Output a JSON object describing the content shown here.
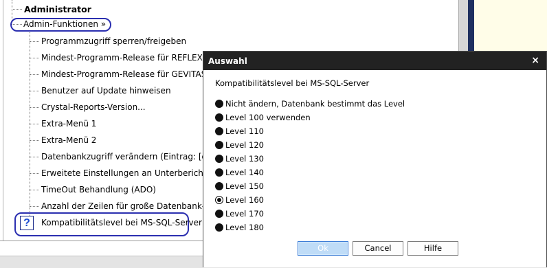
{
  "tree": {
    "root_label": "Administrator",
    "group_label": "Admin-Funktionen »",
    "items": [
      "Programmzugriff sperren/freigeben",
      "Mindest-Programm-Release für REFLEX festl",
      "Mindest-Programm-Release für GEVITAS-For",
      "Benutzer auf Update hinweisen",
      "Crystal-Reports-Version...",
      "Extra-Menü 1",
      "Extra-Menü 2",
      "Datenbankzugriff verändern (Eintrag: [dbo.Re",
      "Erweitete Einstellungen an Unterberichte wei",
      "TimeOut Behandlung (ADO)",
      "Anzahl der Zeilen für große Datenbank-Abfra",
      "Kompatibilitätslevel bei MS-SQL-Server"
    ],
    "help_icon_glyph": "?"
  },
  "dialog": {
    "title": "Auswahl",
    "close_glyph": "×",
    "label": "Kompatibilitätslevel bei MS-SQL-Server",
    "options": [
      "Nicht ändern, Datenbank bestimmt das Level",
      "Level 100 verwenden",
      "Level 110",
      "Level 120",
      "Level 130",
      "Level 140",
      "Level 150",
      "Level 160",
      "Level 170",
      "Level 180"
    ],
    "selected_option": "Level 160",
    "buttons": {
      "ok": "Ok",
      "cancel": "Cancel",
      "help": "Hilfe"
    }
  },
  "colors": {
    "dialog_titlebar": "#222222",
    "annotation_oval": "#2b2fb0",
    "ok_button_bg": "#bfdcf7",
    "sidebar_dark": "#1e2f5f",
    "right_pane_bg": "#fffde8"
  }
}
